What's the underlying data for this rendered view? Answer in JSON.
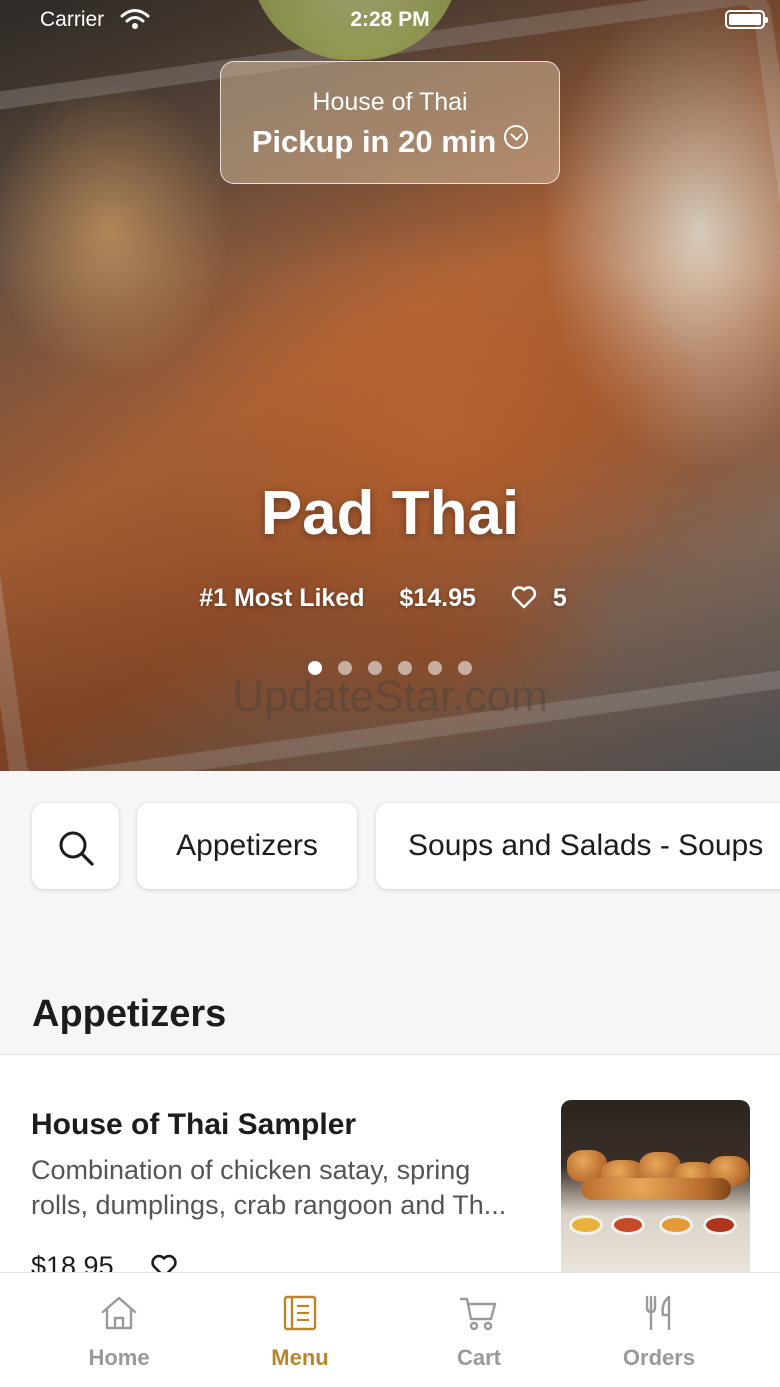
{
  "status_bar": {
    "carrier": "Carrier",
    "time": "2:28 PM"
  },
  "pickup": {
    "restaurant": "House of Thai",
    "time_label": "Pickup in 20 min"
  },
  "featured": {
    "title": "Pad Thai",
    "rank": "#1 Most Liked",
    "price": "$14.95",
    "likes": "5",
    "slide_count": 6,
    "active_slide": 1
  },
  "watermark": "UpdateStar.com",
  "categories": [
    "Appetizers",
    "Soups and Salads - Soups"
  ],
  "section": {
    "title": "Appetizers",
    "items": [
      {
        "name": "House of Thai Sampler",
        "description": "Combination of chicken satay, spring rolls, dumplings, crab rangoon and Th...",
        "price": "$18.95"
      }
    ]
  },
  "tabs": [
    {
      "label": "Home",
      "icon": "home-icon",
      "active": false
    },
    {
      "label": "Menu",
      "icon": "menu-icon",
      "active": true
    },
    {
      "label": "Cart",
      "icon": "cart-icon",
      "active": false
    },
    {
      "label": "Orders",
      "icon": "orders-icon",
      "active": false
    }
  ],
  "colors": {
    "accent": "#b9862a",
    "inactive_tab": "#9a9a9a"
  }
}
